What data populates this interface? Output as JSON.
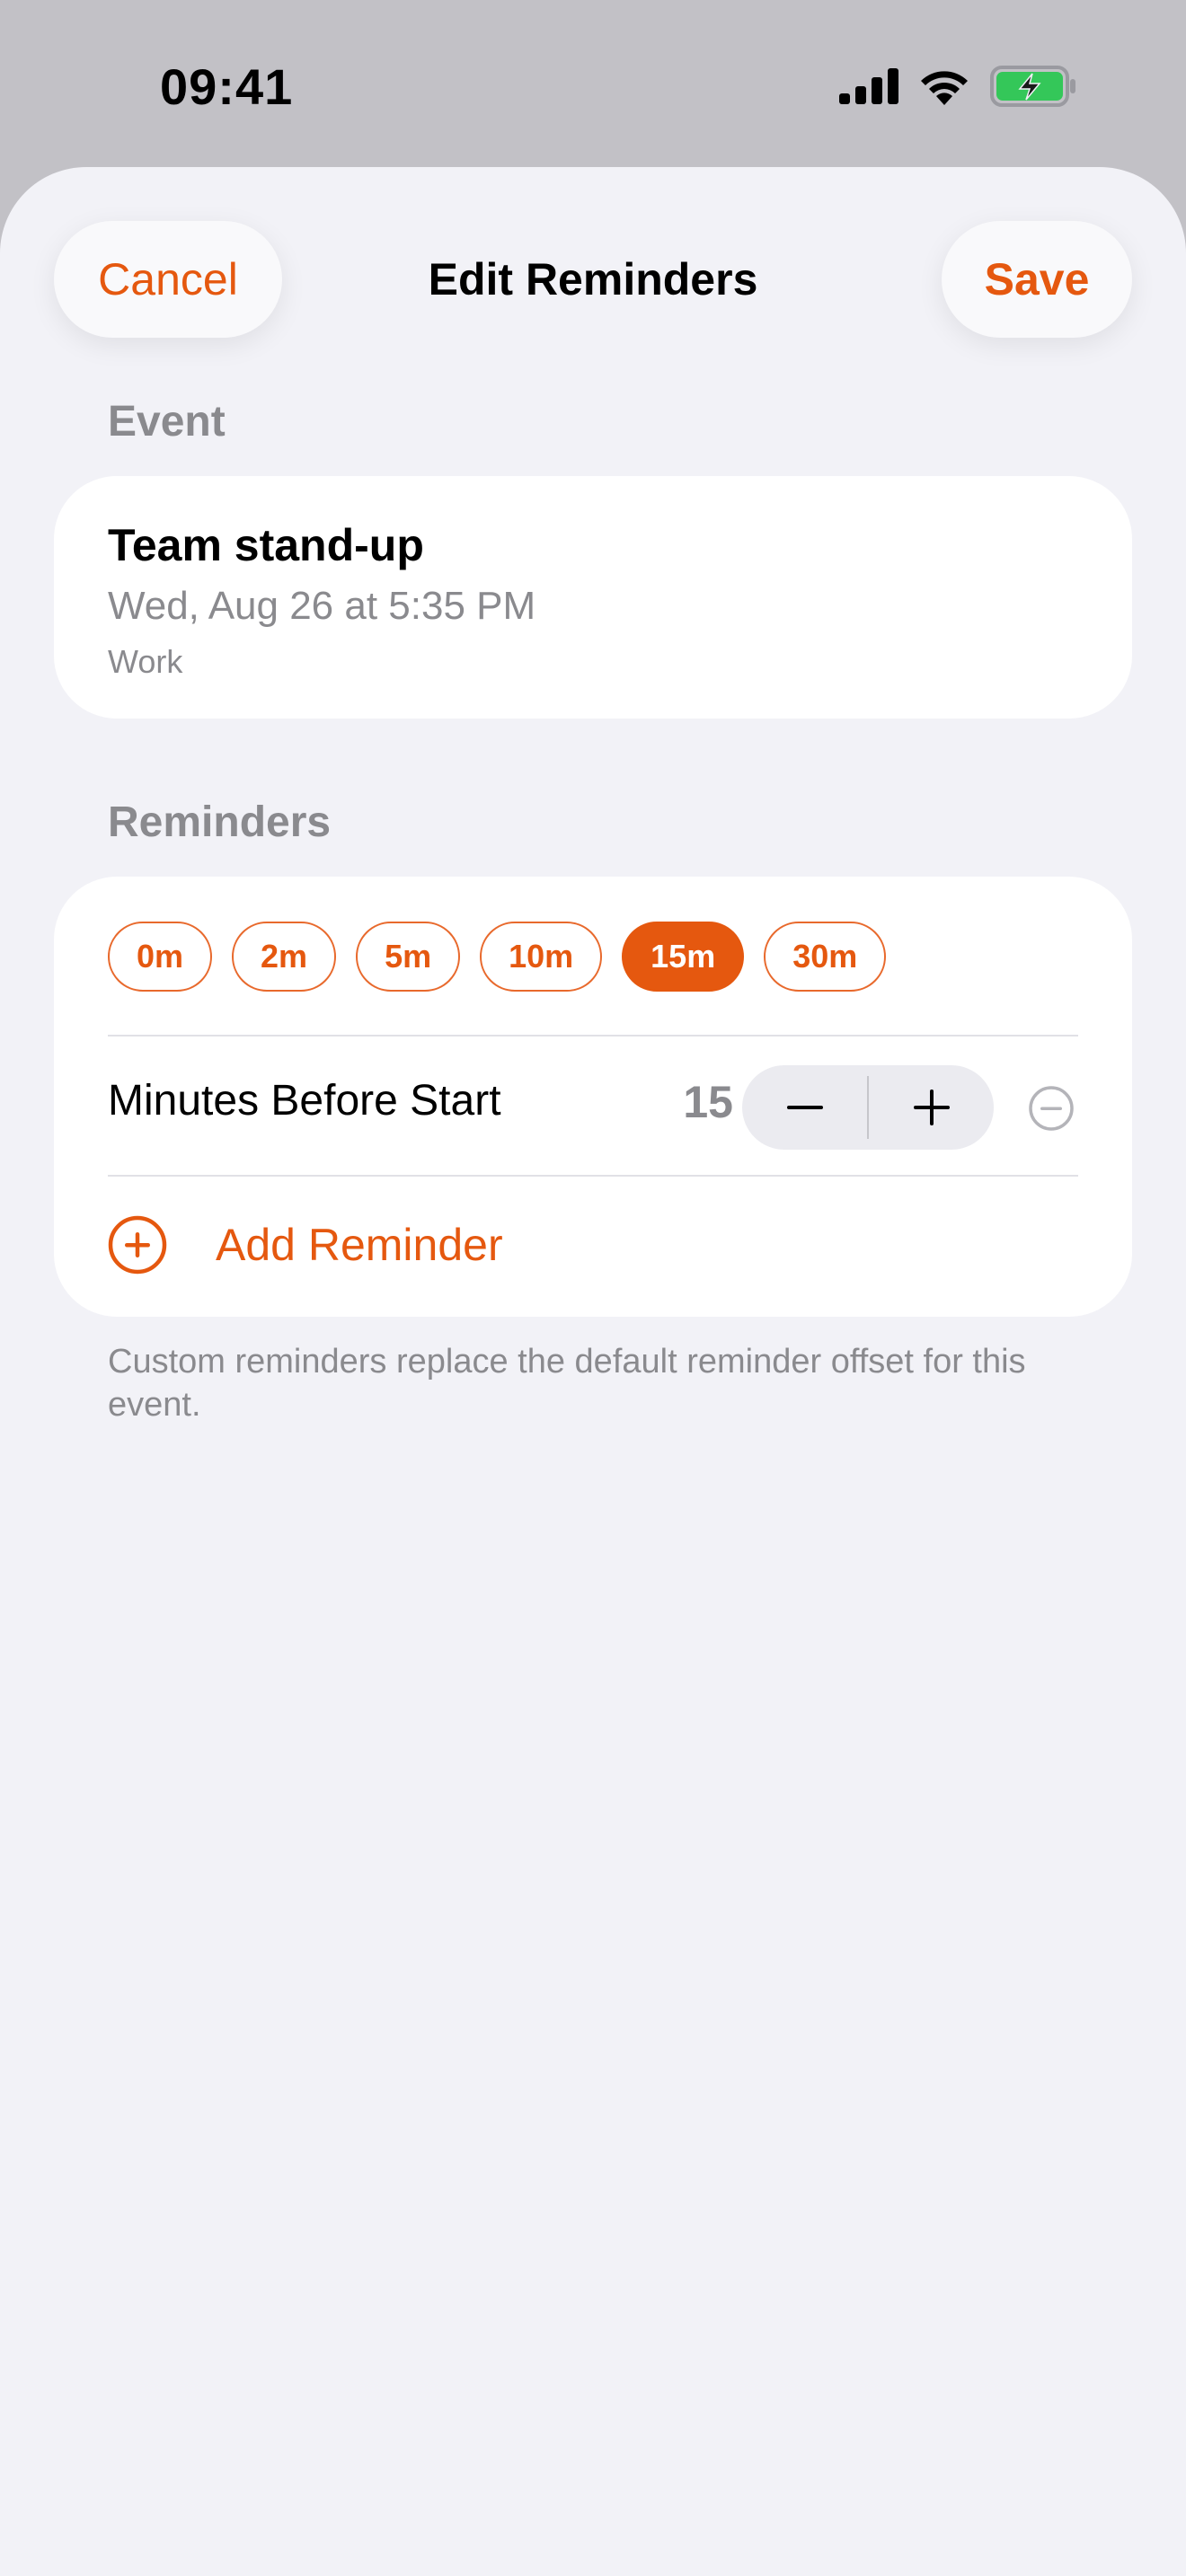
{
  "status_bar": {
    "time": "09:41",
    "icons": [
      "cellular-signal-icon",
      "wifi-icon",
      "battery-charging-icon"
    ],
    "battery_color": "#34c759"
  },
  "nav": {
    "cancel_label": "Cancel",
    "title": "Edit Reminders",
    "save_label": "Save"
  },
  "event_section": {
    "header": "Event",
    "title": "Team stand-up",
    "date": "Wed, Aug 26 at 5:35 PM",
    "calendar": "Work"
  },
  "reminders_section": {
    "header": "Reminders",
    "presets": [
      {
        "label": "0m",
        "selected": false
      },
      {
        "label": "2m",
        "selected": false
      },
      {
        "label": "5m",
        "selected": false
      },
      {
        "label": "10m",
        "selected": false
      },
      {
        "label": "15m",
        "selected": true
      },
      {
        "label": "30m",
        "selected": false
      }
    ],
    "row_label": "Minutes Before Start",
    "row_value": "15",
    "add_label": "Add Reminder",
    "footnote": "Custom reminders replace the default reminder offset for this event."
  },
  "colors": {
    "accent": "#e5580f",
    "secondary_text": "#8a8a8e",
    "background": "#f2f2f7"
  }
}
